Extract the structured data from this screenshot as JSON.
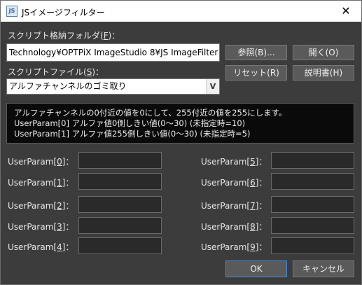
{
  "window": {
    "title": "JSイメージフィルター",
    "icon": "JS"
  },
  "folder": {
    "label_pre": "スクリプト格納フォルダ(",
    "label_key": "F",
    "label_post": ")：",
    "value": "Technology¥OPTPiX ImageStudio 8¥JS ImageFilter"
  },
  "buttons": {
    "browse": "参照(B)...",
    "open": "開く(O)",
    "reset": "リセット(R)",
    "manual": "説明書(H)",
    "ok": "OK",
    "cancel": "キャンセル"
  },
  "script_file": {
    "label_pre": "スクリプトファイル(",
    "label_key": "S",
    "label_post": ")：",
    "selected": "アルファチャンネルのゴミ取り"
  },
  "description": [
    "アルファチャンネルの0付近の値を0にして、255付近の値を255にします。",
    "UserParam[0] アルファ値0側しきい値(0〜30) (未指定時=10)",
    "UserParam[1] アルファ値255側しきい値(0〜30) (未指定時=5)"
  ],
  "params": [
    {
      "pre": "UserParam[",
      "key": "0",
      "post": "]：",
      "value": ""
    },
    {
      "pre": "UserParam[",
      "key": "1",
      "post": "]：",
      "value": ""
    },
    {
      "pre": "UserParam[",
      "key": "2",
      "post": "]：",
      "value": ""
    },
    {
      "pre": "UserParam[",
      "key": "3",
      "post": "]：",
      "value": ""
    },
    {
      "pre": "UserParam[",
      "key": "4",
      "post": "]：",
      "value": ""
    },
    {
      "pre": "UserParam[",
      "key": "5",
      "post": "]：",
      "value": ""
    },
    {
      "pre": "UserParam[",
      "key": "6",
      "post": "]：",
      "value": ""
    },
    {
      "pre": "UserParam[",
      "key": "7",
      "post": "]：",
      "value": ""
    },
    {
      "pre": "UserParam[",
      "key": "8",
      "post": "]：",
      "value": ""
    },
    {
      "pre": "UserParam[",
      "key": "9",
      "post": "]：",
      "value": ""
    }
  ],
  "colors": {
    "background": "#3c3c3c",
    "accent": "#3c8ce0"
  }
}
